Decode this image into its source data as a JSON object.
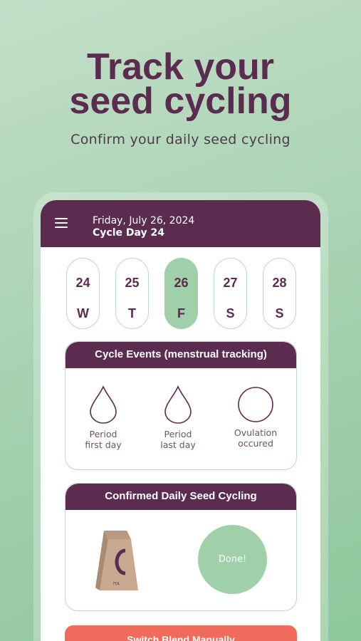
{
  "promo": {
    "title_line1": "Track your",
    "title_line2": "seed cycling",
    "subtitle": "Confirm your daily seed cycling"
  },
  "app": {
    "header": {
      "date": "Friday, July 26, 2024",
      "cycle_day": "Cycle Day 24",
      "menu_icon": "hamburger-menu-icon"
    },
    "days": [
      {
        "num": "24",
        "letter": "W",
        "selected": false
      },
      {
        "num": "25",
        "letter": "T",
        "selected": false
      },
      {
        "num": "26",
        "letter": "F",
        "selected": true
      },
      {
        "num": "27",
        "letter": "S",
        "selected": false
      },
      {
        "num": "28",
        "letter": "S",
        "selected": false
      }
    ],
    "cycle_events": {
      "title": "Cycle Events (menstrual tracking)",
      "items": [
        {
          "label": "Period\nfirst day",
          "icon": "droplet-icon"
        },
        {
          "label": "Period\nlast day",
          "icon": "droplet-icon"
        },
        {
          "label": "Ovulation\noccured",
          "icon": "circle-icon"
        }
      ]
    },
    "seed_cycling": {
      "title": "Confirmed Daily Seed Cycling",
      "bag_label": "FOL",
      "done_label": "Done!"
    },
    "switch_button_label": "Switch Blend Manually"
  },
  "colors": {
    "brand_plum": "#5c2b50",
    "accent_green": "#9fd0aa",
    "button_coral": "#f06b5c"
  }
}
